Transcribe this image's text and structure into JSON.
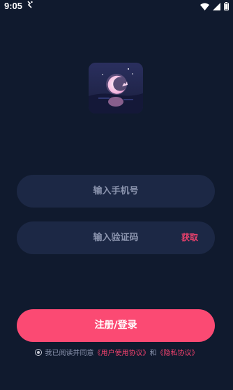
{
  "status": {
    "time": "9:05",
    "notification_glyph": "ⓘ"
  },
  "form": {
    "phone_placeholder": "输入手机号",
    "code_placeholder": "输入验证码",
    "get_code_label": "获取",
    "submit_label": "注册/登录"
  },
  "agreement": {
    "prefix": "我已阅读并同意",
    "user_agreement": "《用户使用协议》",
    "and": "和",
    "privacy_agreement": "《隐私协议》"
  },
  "colors": {
    "accent": "#fb4a73",
    "background": "#101a2e",
    "field": "#1c2845"
  }
}
